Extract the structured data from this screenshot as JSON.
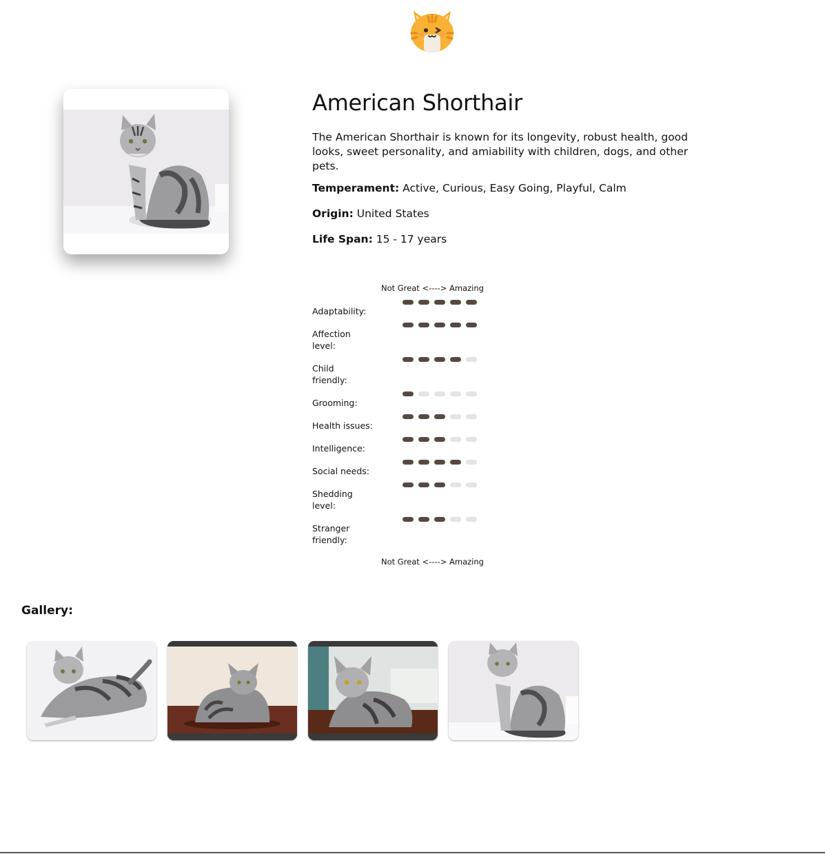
{
  "breed": {
    "name": "American Shorthair",
    "description": "The American Shorthair is known for its longevity, robust health, good looks, sweet personality, and amiability with children, dogs, and other pets.",
    "facts": [
      {
        "label": "Temperament:",
        "value": "Active, Curious, Easy Going, Playful, Calm"
      },
      {
        "label": "Origin:",
        "value": "United States"
      },
      {
        "label": "Life Span:",
        "value": "15 - 17 years"
      }
    ]
  },
  "scale": {
    "top": "Not Great <----> Amazing",
    "bottom": "Not Great <----> Amazing",
    "max": 5
  },
  "ratings": [
    {
      "label": "Adaptability:",
      "value": 5
    },
    {
      "label": "Affection level:",
      "value": 5
    },
    {
      "label": "Child friendly:",
      "value": 4
    },
    {
      "label": "Grooming:",
      "value": 1
    },
    {
      "label": "Health issues:",
      "value": 3
    },
    {
      "label": "Intelligence:",
      "value": 3
    },
    {
      "label": "Social needs:",
      "value": 4
    },
    {
      "label": "Shedding level:",
      "value": 3
    },
    {
      "label": "Stranger friendly:",
      "value": 3
    }
  ],
  "gallery": {
    "heading": "Gallery:",
    "count": 4
  },
  "colors": {
    "rating_on": "#564942",
    "rating_off": "#e4e4e4",
    "logo_orange": "#f6a623"
  },
  "icons": {
    "logo": "cat-face-winking-icon"
  }
}
